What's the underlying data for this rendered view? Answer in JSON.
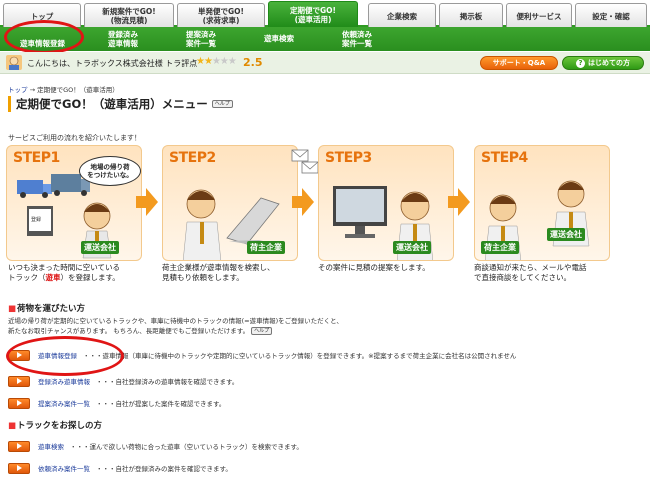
{
  "tabs": [
    {
      "label": "トップ"
    },
    {
      "label": "新規案件でGO!\n(物流見積)"
    },
    {
      "label": "単発便でGO!\n(求荷求車)"
    },
    {
      "label": "定期便でGO!\n(遊車活用)"
    },
    {
      "label": "企業検索"
    },
    {
      "label": "掲示板"
    },
    {
      "label": "便利サービス"
    },
    {
      "label": "設定・確認"
    }
  ],
  "subnav": [
    {
      "label": "遊車情報登録"
    },
    {
      "label": "登録済み\n遊車情報"
    },
    {
      "label": "提案済み\n案件一覧"
    },
    {
      "label": "遊車検索"
    },
    {
      "label": "依頼済み\n案件一覧"
    }
  ],
  "help_label": "ヘルプ",
  "userbar": {
    "greeting": "こんにちは、トラボックス株式会社様 トラ評点",
    "stars_on": "★★",
    "stars_off": "★★★",
    "rating": "2.5",
    "support_label": "サポート・Q&A",
    "first_label": "はじめての方"
  },
  "breadcrumb": {
    "home": "トップ",
    "sep": "→",
    "current": "定期便でGO！（遊車活用）"
  },
  "page_title": "定期便でGO！（遊車活用）メニュー",
  "intro": "サービスご利用の流れを紹介いたします！",
  "steps": [
    {
      "title": "STEP1",
      "role": "運送会社",
      "bubble": "地場の帰り荷\nをつけたいな。",
      "caption_a": "いつも決まった時間に空いている",
      "caption_b": "トラック（",
      "caption_red": "遊車",
      "caption_c": "）を登録します。"
    },
    {
      "title": "STEP2",
      "role": "荷主企業",
      "caption_a": "荷主企業様が遊車情報を検索し、",
      "caption_b": "見積もり依頼をします。"
    },
    {
      "title": "STEP3",
      "role": "運送会社",
      "caption_a": "その案件に見積の提案をします。"
    },
    {
      "title": "STEP4",
      "role": "荷主企業",
      "role2": "運送会社",
      "caption_a": "商談通知が来たら、メールや電話",
      "caption_b": "で直接商談をしてください。"
    }
  ],
  "section1": {
    "title": "荷物を運びたい方",
    "desc_a": "近場の帰り荷が定期的に空いているトラックや、車庫に待機中のトラックの情報(=遊車情報)をご登録いただくと、",
    "desc_b": "新たなお取引チャンスがあります。 もちろん、長距離便でもご登録いただけます。",
    "rows": [
      {
        "link": "遊車情報登録",
        "desc": "・・・遊車情報（車庫に待機中のトラックや定期的に空いているトラック情報）を登録できます。※提案するまで荷主企業に会社名は公開されません"
      },
      {
        "link": "登録済み遊車情報",
        "desc": "・・・自社登録済みの遊車情報を確認できます。"
      },
      {
        "link": "提案済み案件一覧",
        "desc": "・・・自社が提案した案件を確認できます。"
      }
    ]
  },
  "section2": {
    "title": "トラックをお探しの方",
    "rows": [
      {
        "link": "遊車検索",
        "desc": "・・・運んで欲しい荷物に合った遊車（空いているトラック）を検索できます。"
      },
      {
        "link": "依頼済み案件一覧",
        "desc": "・・・自社が登録済みの案件を確認できます。"
      }
    ]
  },
  "colors": {
    "accent_green": "#2f9a22",
    "accent_orange": "#f39a1f",
    "annotation_red": "#e01515"
  }
}
